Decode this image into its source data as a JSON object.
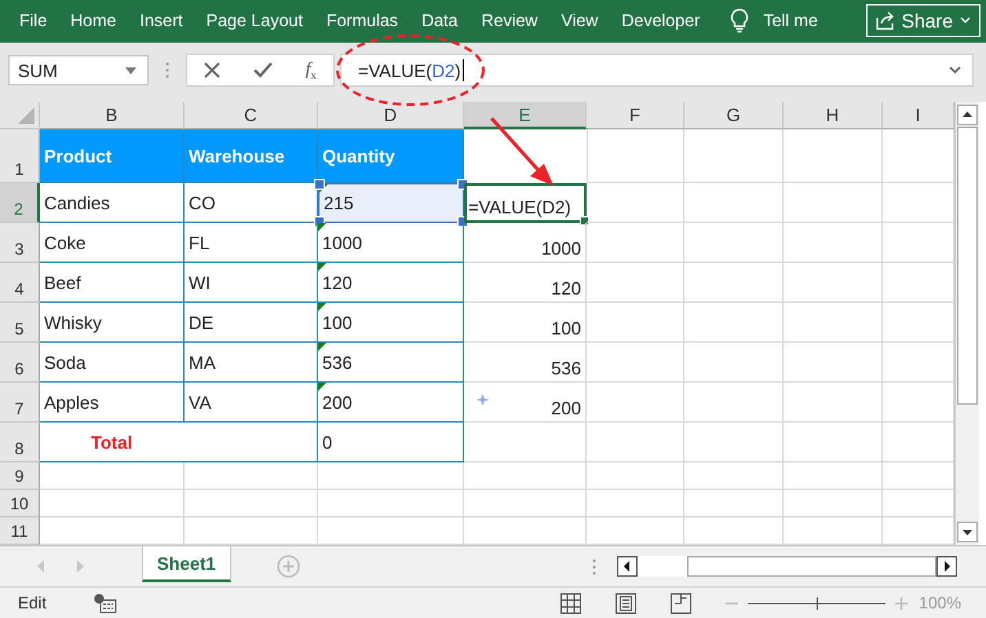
{
  "ribbon": {
    "tabs": [
      {
        "label": "File",
        "selected": false
      },
      {
        "label": "Home",
        "selected": false
      },
      {
        "label": "Insert",
        "selected": false
      },
      {
        "label": "Page Layout",
        "selected": false
      },
      {
        "label": "Formulas",
        "selected": false
      },
      {
        "label": "Data",
        "selected": false
      },
      {
        "label": "Review",
        "selected": false
      },
      {
        "label": "View",
        "selected": false
      },
      {
        "label": "Developer",
        "selected": false
      }
    ],
    "tell_me": "Tell me",
    "share": "Share"
  },
  "formula_bar": {
    "name_box": "SUM",
    "function_button": "*f*$_{x}$",
    "formula_prefix": "=VALUE(",
    "formula_reference": "D2",
    "formula_suffix": ")"
  },
  "columns": [
    {
      "label": "B",
      "selected": false
    },
    {
      "label": "C",
      "selected": false
    },
    {
      "label": "D",
      "selected": false
    },
    {
      "label": "E",
      "selected": true
    },
    {
      "label": "F",
      "selected": false
    },
    {
      "label": "G",
      "selected": false
    },
    {
      "label": "H",
      "selected": false
    },
    {
      "label": "I",
      "selected": false
    }
  ],
  "header_row": {
    "number": "1",
    "selected": false,
    "labels": [
      "Product",
      "Warehouse",
      "Quantity"
    ]
  },
  "rows": [
    {
      "number": "2",
      "selected": true,
      "product": "Candies",
      "warehouse": "CO",
      "quantity": "215",
      "quantity_selected": true,
      "number_as_text": true,
      "result": "=VALUE(D2)",
      "editing": true
    },
    {
      "number": "3",
      "selected": false,
      "product": "Coke",
      "warehouse": "FL",
      "quantity": "1000",
      "quantity_selected": false,
      "number_as_text": true,
      "result": "1000",
      "editing": false
    },
    {
      "number": "4",
      "selected": false,
      "product": "Beef",
      "warehouse": "WI",
      "quantity": "120",
      "quantity_selected": false,
      "number_as_text": true,
      "result": "120",
      "editing": false
    },
    {
      "number": "5",
      "selected": false,
      "product": "Whisky",
      "warehouse": "DE",
      "quantity": "100",
      "quantity_selected": false,
      "number_as_text": true,
      "result": "100",
      "editing": false
    },
    {
      "number": "6",
      "selected": false,
      "product": "Soda",
      "warehouse": "MA",
      "quantity": "536",
      "quantity_selected": false,
      "number_as_text": true,
      "result": "536",
      "editing": false
    },
    {
      "number": "7",
      "selected": false,
      "product": "Apples",
      "warehouse": "VA",
      "quantity": "200",
      "quantity_selected": false,
      "number_as_text": true,
      "result": "200",
      "editing": false
    }
  ],
  "total_row": {
    "number": "8",
    "selected": false,
    "label": "Total",
    "quantity": "0"
  },
  "empty_rows": [
    {
      "number": "9",
      "selected": false
    },
    {
      "number": "10",
      "selected": false
    },
    {
      "number": "11",
      "selected": false
    }
  ],
  "sheet_tabs": [
    {
      "label": "Sheet1",
      "selected": true
    }
  ],
  "status_bar": {
    "mode": "Edit",
    "zoom": "100%",
    "zoom_level": {
      "level": 0.5
    }
  }
}
